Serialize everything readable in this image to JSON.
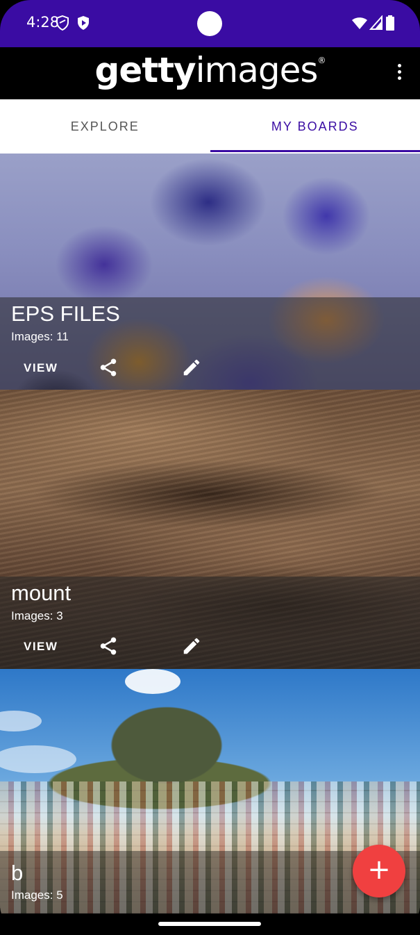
{
  "status_bar": {
    "time": "4:28",
    "icons": [
      "shield-icon",
      "play-protect-icon",
      "wifi-icon",
      "signal-icon",
      "battery-icon"
    ]
  },
  "app_bar": {
    "logo_bold": "getty",
    "logo_regular": "images",
    "logo_mark": "®",
    "menu_icon": "more-vert-icon"
  },
  "tabs": [
    {
      "label": "EXPLORE",
      "active": false
    },
    {
      "label": "MY BOARDS",
      "active": true
    }
  ],
  "boards": [
    {
      "title": "EPS FILES",
      "count": "Images: 11",
      "view_label": "VIEW",
      "share_icon": "share-icon",
      "edit_icon": "edit-icon"
    },
    {
      "title": "mount",
      "count": "Images: 3",
      "view_label": "VIEW",
      "share_icon": "share-icon",
      "edit_icon": "edit-icon"
    },
    {
      "title": "b",
      "count": "Images: 5"
    }
  ],
  "fab": {
    "label": "+",
    "icon": "add-icon"
  },
  "colors": {
    "status_bar": "#3a0ca3",
    "accent": "#3a0ca3",
    "fab": "#f04040"
  }
}
